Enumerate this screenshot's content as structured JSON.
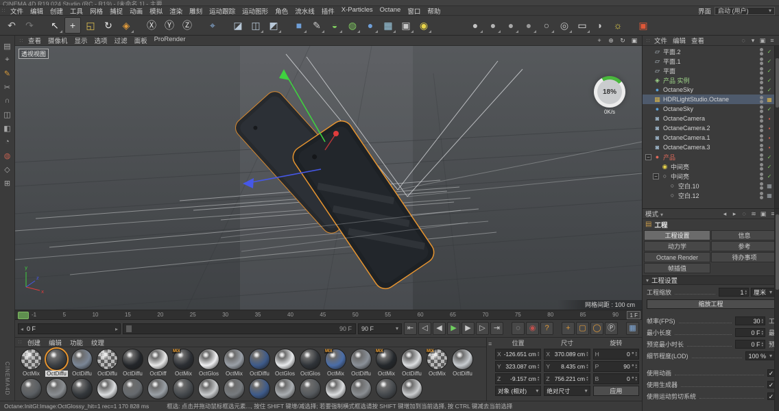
{
  "window": {
    "title": "CINEMA 4D R19.024 Studio (RC - R19) - [未命名 1] - 主要"
  },
  "menubar": {
    "items": [
      "文件",
      "编辑",
      "创建",
      "工具",
      "网格",
      "捕捉",
      "动画",
      "模拟",
      "渲染",
      "雕刻",
      "运动跟踪",
      "运动图形",
      "角色",
      "流水线",
      "插件",
      "X-Particles",
      "Octane",
      "窗口",
      "帮助"
    ],
    "interface_label": "界面",
    "layout_value": "启动 (用户)"
  },
  "toolbar": {
    "icons": [
      {
        "name": "undo-icon",
        "glyph": "↶",
        "color": "#c9c9c9"
      },
      {
        "name": "redo-icon",
        "glyph": "↷",
        "color": "#757575"
      },
      {
        "name": "live-selection-icon",
        "glyph": "↖",
        "color": "#e8e8e8",
        "dd": true,
        "gap": "s"
      },
      {
        "name": "move-tool-icon",
        "glyph": "+",
        "color": "#e8e8e8",
        "active": true
      },
      {
        "name": "scale-tool-icon",
        "glyph": "◱",
        "color": "#e0c050"
      },
      {
        "name": "rotate-tool-icon",
        "glyph": "↻",
        "color": "#e8e8e8"
      },
      {
        "name": "last-tool-icon",
        "glyph": "◈",
        "color": "#e09a3a",
        "dd": true
      },
      {
        "name": "lock-x-icon",
        "glyph": "Ⓧ",
        "color": "#d8d8d8",
        "gap": "s"
      },
      {
        "name": "lock-y-icon",
        "glyph": "Ⓨ",
        "color": "#d8d8d8"
      },
      {
        "name": "lock-z-icon",
        "glyph": "Ⓩ",
        "color": "#d8d8d8"
      },
      {
        "name": "coord-system-icon",
        "glyph": "⌖",
        "color": "#8fb8e8",
        "gap": "s"
      },
      {
        "name": "render-view-icon",
        "glyph": "◪",
        "color": "#b8c8d8",
        "gap": "s"
      },
      {
        "name": "render-picture-viewer-icon",
        "glyph": "◫",
        "color": "#b8c8d8",
        "dd": true
      },
      {
        "name": "render-settings-icon",
        "glyph": "◩",
        "color": "#b8c8d8",
        "dd": true
      },
      {
        "name": "add-cube-icon",
        "glyph": "■",
        "color": "#6f9fd8",
        "dd": true,
        "gap": "s"
      },
      {
        "name": "add-spline-icon",
        "glyph": "✎",
        "color": "#c8c8c8",
        "dd": true
      },
      {
        "name": "add-generator-icon",
        "glyph": "◒",
        "color": "#7ec95f",
        "dd": true
      },
      {
        "name": "add-deformer-icon",
        "glyph": "◍",
        "color": "#7ec95f",
        "dd": true
      },
      {
        "name": "add-volume-icon",
        "glyph": "●",
        "color": "#6f9fd8",
        "dd": true
      },
      {
        "name": "add-cloner-icon",
        "glyph": "▦",
        "color": "#9fd0e8",
        "dd": true
      },
      {
        "name": "add-camera-icon",
        "glyph": "▣",
        "color": "#c8c8c8",
        "dd": true
      },
      {
        "name": "add-light-icon",
        "glyph": "◉",
        "color": "#e8d44a",
        "dd": true
      },
      {
        "name": "display-gouraud-icon",
        "glyph": "●",
        "color": "#c4c4c4",
        "dd": true,
        "gap": "l"
      },
      {
        "name": "display-quickshade-icon",
        "glyph": "●",
        "color": "#b4b4b4",
        "dd": true
      },
      {
        "name": "display-constant-icon",
        "glyph": "●",
        "color": "#a8a8a8",
        "dd": true
      },
      {
        "name": "display-hiddenline-icon",
        "glyph": "●",
        "color": "#989898",
        "dd": true
      },
      {
        "name": "display-wireframe-icon",
        "glyph": "○",
        "color": "#c4c4c4",
        "dd": true
      },
      {
        "name": "stereo-view-icon",
        "glyph": "◎",
        "color": "#c4c4c4",
        "dd": true
      },
      {
        "name": "snap-settings-icon",
        "glyph": "▭",
        "color": "#e8e8e8",
        "dd": true
      },
      {
        "name": "half-sphere-icon",
        "glyph": "◗",
        "color": "#c4c4c4"
      },
      {
        "name": "sun-light-icon",
        "glyph": "☼",
        "color": "#e8d44a"
      },
      {
        "name": "octane-live-viewer-icon",
        "glyph": "▣",
        "color": "#e05838",
        "gap": "s"
      }
    ]
  },
  "left_dock": {
    "brand": "CINEMA4D",
    "icons": [
      {
        "name": "uv-grid-icon",
        "glyph": "▤",
        "color": "#a8a8a8"
      },
      {
        "name": "axis-mode-icon",
        "glyph": "⌖",
        "color": "#a8a8a8"
      },
      {
        "name": "brush-icon",
        "glyph": "✎",
        "color": "#d89a3a"
      },
      {
        "name": "knife-icon",
        "glyph": "✂",
        "color": "#a8a8a8"
      },
      {
        "name": "magnet-icon",
        "glyph": "∩",
        "color": "#a8a8a8"
      },
      {
        "name": "mirror-icon",
        "glyph": "◫",
        "color": "#a8a8a8"
      },
      {
        "name": "extrude-icon",
        "glyph": "◧",
        "color": "#a8a8a8"
      },
      {
        "name": "smooth-icon",
        "glyph": "◔",
        "color": "#a8a8a8"
      },
      {
        "name": "weight-paint-icon",
        "glyph": "◍",
        "color": "#c06050"
      },
      {
        "name": "snap-toggle-icon",
        "glyph": "◇",
        "color": "#a8a8a8"
      },
      {
        "name": "workplane-icon",
        "glyph": "⊞",
        "color": "#a8a8a8"
      }
    ]
  },
  "viewport": {
    "menu": [
      "查看",
      "摄像机",
      "显示",
      "选项",
      "过滤",
      "面板",
      "ProRender"
    ],
    "nav_icons": [
      {
        "name": "pan-view-icon",
        "glyph": "+"
      },
      {
        "name": "zoom-view-icon",
        "glyph": "⊕"
      },
      {
        "name": "rotate-view-icon",
        "glyph": "↻"
      },
      {
        "name": "toggle-view-icon",
        "glyph": "▣"
      }
    ],
    "view_label": "透视视图",
    "progress_percent": "18%",
    "net_speed": "0K/s",
    "grid_info": "网格间距 : 100 cm"
  },
  "timeline": {
    "ticks": [
      "-1",
      "5",
      "10",
      "15",
      "20",
      "25",
      "30",
      "35",
      "40",
      "45",
      "50",
      "55",
      "60",
      "65",
      "70",
      "75",
      "80",
      "85",
      "90"
    ],
    "range_badge": "1 F",
    "current_frame": "0 F",
    "slider_end": "90 F",
    "range_select": "90 F",
    "buttons": [
      {
        "name": "goto-start-button",
        "glyph": "⇤",
        "color": "#c8c8c8"
      },
      {
        "name": "prev-key-button",
        "glyph": "◁",
        "color": "#c8c8c8"
      },
      {
        "name": "prev-frame-button",
        "glyph": "◀",
        "color": "#c8c8c8"
      },
      {
        "name": "play-button",
        "glyph": "▶",
        "color": "#6fcf5f"
      },
      {
        "name": "next-frame-button",
        "glyph": "▶",
        "color": "#c8c8c8"
      },
      {
        "name": "next-key-button",
        "glyph": "▷",
        "color": "#c8c8c8"
      },
      {
        "name": "goto-end-button",
        "glyph": "⇥",
        "color": "#c8c8c8"
      },
      {
        "name": "record-button",
        "glyph": "◌",
        "color": "#b4b4b4",
        "g": "s"
      },
      {
        "name": "autokey-button",
        "glyph": "◉",
        "color": "#c0504d"
      },
      {
        "name": "keyframe-selection-button",
        "glyph": "?",
        "color": "#e09a3a"
      },
      {
        "name": "record-position-button",
        "glyph": "+",
        "color": "#e09a3a",
        "g": "s"
      },
      {
        "name": "record-scale-button",
        "glyph": "▢",
        "color": "#e09a3a"
      },
      {
        "name": "record-rotation-button",
        "glyph": "◯",
        "color": "#e09a3a"
      },
      {
        "name": "record-parameter-button",
        "glyph": "Ⓟ",
        "color": "#d8d8d8"
      },
      {
        "name": "motion-system-button",
        "glyph": "▦",
        "color": "#7fa8d8",
        "g": "s"
      }
    ]
  },
  "materials": {
    "menu": [
      "创建",
      "编辑",
      "功能",
      "纹理"
    ],
    "items": [
      {
        "name": "OctMix",
        "kind": "checker"
      },
      {
        "name": "OctDiffu",
        "color": "#3a3e42",
        "selected": true
      },
      {
        "name": "OctDiffu",
        "color": "#7a8696"
      },
      {
        "name": "OctDiffu",
        "kind": "checker"
      },
      {
        "name": "OctDiffu",
        "color": "#23262a"
      },
      {
        "name": "OctDiff",
        "color": "#e8e8e8"
      },
      {
        "name": "OctMix",
        "color": "#2b2e33",
        "badge": "MIX"
      },
      {
        "name": "OctGlos",
        "color": "#f0f0f2"
      },
      {
        "name": "OctMix",
        "color": "#9aa0a8"
      },
      {
        "name": "OctDiffu",
        "color": "#3d5a8a"
      },
      {
        "name": "OctGlos",
        "color": "#e8eaec"
      },
      {
        "name": "OctGlos",
        "color": "#2f3338"
      },
      {
        "name": "OctMix",
        "color": "#4a6da8",
        "badge": "MIX"
      },
      {
        "name": "OctDiffu",
        "color": "#8a9098"
      },
      {
        "name": "OctMix",
        "color": "#24282c",
        "badge": "MIX"
      },
      {
        "name": "OctDiffu",
        "color": "#dcdee0"
      },
      {
        "name": "OctMix",
        "kind": "checker",
        "badge": "MIX"
      },
      {
        "name": "OctDiffu",
        "color": "#c8ccd0"
      }
    ],
    "row2": [
      {
        "color": "#5a5e62"
      },
      {
        "color": "#8a8e92"
      },
      {
        "color": "#33373b"
      },
      {
        "color": "#dcdee0"
      },
      {
        "color": "#666a6e"
      },
      {
        "color": "#9aa0a6"
      },
      {
        "color": "#44484c"
      },
      {
        "color": "#caccce"
      },
      {
        "color": "#777b7f"
      },
      {
        "color": "#3d5a8a"
      },
      {
        "color": "#aaaeb2"
      },
      {
        "color": "#55595d"
      },
      {
        "color": "#dcdee0"
      },
      {
        "color": "#8a8e92"
      },
      {
        "color": "#44484c"
      },
      {
        "color": "#caccce"
      }
    ]
  },
  "coordinates": {
    "pos_header": "位置",
    "size_header": "尺寸",
    "rot_header": "旋转",
    "px_label": "X",
    "px": "-126.651 cm",
    "py_label": "Y",
    "py": "323.087 cm",
    "pz_label": "Z",
    "pz": "-9.157 cm",
    "sx_label": "X",
    "sx": "370.089 cm",
    "sy_label": "Y",
    "sy": "8.435 cm",
    "sz_label": "Z",
    "sz": "756.221 cm",
    "rh_label": "H",
    "rh": "0 °",
    "rp_label": "P",
    "rp": "90 °",
    "rb_label": "B",
    "rb": "0 °",
    "mode_object": "对象 (相对)",
    "mode_size": "绝对尺寸",
    "apply_label": "应用"
  },
  "object_manager": {
    "menu": [
      "文件",
      "编辑",
      "查看"
    ],
    "menu_icons": [
      {
        "name": "search-icon",
        "glyph": "◌"
      },
      {
        "name": "view-mode-icon",
        "glyph": "▾"
      },
      {
        "name": "lock-icon",
        "glyph": "▣"
      },
      {
        "name": "options-icon",
        "glyph": "≡"
      }
    ],
    "items": [
      {
        "label": "平面.2",
        "icon_glyph": "▱",
        "icon_color": "#b8c4cc",
        "tag_glyph": "✓",
        "tag_color": "#7ec95f"
      },
      {
        "label": "平面.1",
        "icon_glyph": "▱",
        "icon_color": "#b8c4cc",
        "tag_glyph": "✓",
        "tag_color": "#7ec95f"
      },
      {
        "label": "平面",
        "icon_glyph": "▱",
        "icon_color": "#b8c4cc",
        "tag_glyph": "✓",
        "tag_color": "#7ec95f"
      },
      {
        "label": "产品 实例",
        "label_color": "#9fd489",
        "icon_glyph": "◈",
        "icon_color": "#9fd489",
        "tag_glyph": "✓",
        "tag_color": "#7ec95f"
      },
      {
        "label": "OctaneSky",
        "icon_glyph": "●",
        "icon_color": "#5aa0d8",
        "tag_glyph": "✓",
        "tag_color": "#7ec95f"
      },
      {
        "label": "HDRLightStudio.Octane",
        "icon_glyph": "▦",
        "icon_color": "#d8b44a",
        "selected": true,
        "tag_glyph": "▦",
        "tag_color": "#d8b44a"
      },
      {
        "label": "OctaneSky",
        "icon_glyph": "●",
        "icon_color": "#5aa0d8",
        "tag_glyph": "✓",
        "tag_color": "#7ec95f"
      },
      {
        "label": "OctaneCamera",
        "icon_glyph": "◙",
        "icon_color": "#9fb8cc",
        "tag_glyph": "▪",
        "tag_color": "#d05a4a"
      },
      {
        "label": "OctaneCamera.2",
        "icon_glyph": "◙",
        "icon_color": "#9fb8cc",
        "tag_glyph": "▪",
        "tag_color": "#d05a4a"
      },
      {
        "label": "OctaneCamera.1",
        "icon_glyph": "◙",
        "icon_color": "#9fb8cc",
        "tag_glyph": "▪",
        "tag_color": "#d05a4a"
      },
      {
        "label": "OctaneCamera.3",
        "icon_glyph": "◙",
        "icon_color": "#9fb8cc",
        "tag_glyph": "▪",
        "tag_color": "#d05a4a"
      },
      {
        "exp": "−",
        "label": "产品",
        "label_color": "#e06a5a",
        "icon_glyph": "●",
        "icon_color": "#e06a5a",
        "tag_glyph": "✓",
        "tag_color": "#7ec95f"
      },
      {
        "indent": 1,
        "label": "中间亮",
        "icon_glyph": "◉",
        "icon_color": "#e8d44a",
        "tag_glyph": "✓",
        "tag_color": "#7ec95f"
      },
      {
        "indent": 1,
        "exp": "−",
        "label": "中间亮",
        "icon_glyph": "○",
        "icon_color": "#b8b8b8",
        "tag_glyph": "✓",
        "tag_color": "#7ec95f"
      },
      {
        "indent": 2,
        "label": "空白.10",
        "icon_glyph": "○",
        "icon_color": "#b8b8b8",
        "tag_glyph": "▦",
        "tag_color": "#9aa0a6"
      },
      {
        "indent": 2,
        "label": "空白.12",
        "icon_glyph": "○",
        "icon_color": "#b8b8b8",
        "tag_glyph": "▦",
        "tag_color": "#9aa0a6"
      }
    ]
  },
  "attributes": {
    "mode_label": "模式",
    "mode_icons": [
      {
        "name": "history-back-icon",
        "glyph": "◂"
      },
      {
        "name": "history-forward-icon",
        "glyph": "▸"
      },
      {
        "name": "search-icon",
        "glyph": "◌"
      },
      {
        "name": "filter-icon",
        "glyph": "≋"
      },
      {
        "name": "lock-icon",
        "glyph": "▣"
      },
      {
        "name": "settings-icon",
        "glyph": "≡"
      }
    ],
    "object_title": "工程",
    "tabs": [
      {
        "label": "工程设置",
        "active": true
      },
      {
        "label": "信息"
      },
      {
        "label": "动力学"
      },
      {
        "label": "参考"
      },
      {
        "label": "Octane Render"
      },
      {
        "label": "待办事项"
      },
      {
        "label": "帧插值"
      }
    ],
    "section_title": "工程设置",
    "scale_label": "工程缩放",
    "scale_value": "1",
    "scale_unit": "厘米",
    "scale_button": "缩放工程",
    "fps_label": "帧率(FPS)",
    "fps_value": "30",
    "min_label": "最小长度",
    "min_value": "0 F",
    "preview_label": "预览最小时长",
    "preview_value": "0 F",
    "lod_label": "细节程度(LOD)",
    "lod_value": "100 %",
    "anim_label": "使用动画",
    "gen_label": "使用生成器",
    "motion_label": "使用运动剪切系统",
    "check_glyph": "✓",
    "clipped": [
      "工",
      "最",
      "预"
    ]
  },
  "statusbar": {
    "left": "Octane:InitGl:Image:OctGlossy_hit=1 rec=1  170 828 ms",
    "hint": "框选: 点击并拖动鼠标框选元素..., 按住 SHIFT 键增/减选择; 若要强制横式框选请按 SHIFT 键增加到当前选择, 按 CTRL 键减去当前选择"
  }
}
